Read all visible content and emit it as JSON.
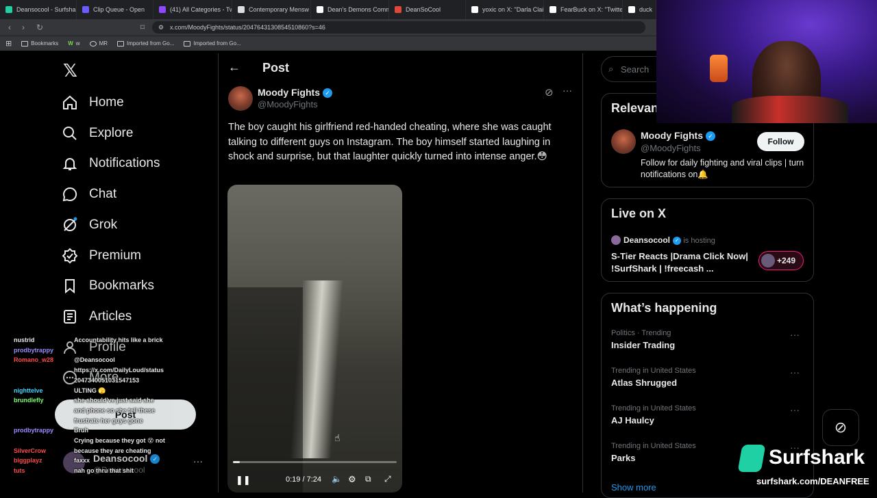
{
  "browser": {
    "tabs": [
      {
        "title": "Deansocool - Surfshark",
        "color": "#1ed0a4"
      },
      {
        "title": "Clip Queue - Open",
        "color": "#6a5cff"
      },
      {
        "title": "(41) All Categories - Tw",
        "color": "#9146ff"
      },
      {
        "title": "Contemporary Mensw",
        "color": "#dddddd"
      },
      {
        "title": "Dean's Demons Comm",
        "color": "#ffffff"
      },
      {
        "title": "DeanSoCool",
        "color": "#e0463a"
      },
      {
        "title": "yoxic on X: \"Darla Clair",
        "color": "#ffffff"
      },
      {
        "title": "FearBuck on X: \"Twitte",
        "color": "#ffffff"
      },
      {
        "title": "duck",
        "color": "#ffffff"
      }
    ],
    "url": "x.com/MoodyFights/status/2047643130854510860?s=46",
    "bookmarks": [
      "Bookmarks",
      "w",
      "MR",
      "Imported from Go...",
      "Imported from Go..."
    ]
  },
  "nav": {
    "items": [
      {
        "label": "Home",
        "icon": "home-icon"
      },
      {
        "label": "Explore",
        "icon": "search-icon"
      },
      {
        "label": "Notifications",
        "icon": "bell-icon"
      },
      {
        "label": "Chat",
        "icon": "chat-icon"
      },
      {
        "label": "Grok",
        "icon": "grok-icon"
      },
      {
        "label": "Premium",
        "icon": "premium-icon"
      },
      {
        "label": "Bookmarks",
        "icon": "bookmark-icon"
      },
      {
        "label": "Articles",
        "icon": "article-icon"
      },
      {
        "label": "Profile",
        "icon": "profile-icon"
      },
      {
        "label": "More",
        "icon": "more-icon"
      }
    ],
    "post_label": "Post",
    "account_name": "Deansocool",
    "account_handle": "@Deansocool"
  },
  "post": {
    "header": "Post",
    "author_name": "Moody Fights",
    "author_handle": "@MoodyFights",
    "text": "The boy caught his girlfriend red-handed cheating, where she was caught talking to different guys on Instagram. The boy himself started laughing in shock and surprise, but that laughter quickly turned into intense anger.😳",
    "video": {
      "time": "0:19 / 7:24",
      "progress": 0.043
    }
  },
  "sidebar": {
    "search_placeholder": "Search",
    "relevant_title": "Relevant people",
    "relevant": {
      "name": "Moody Fights",
      "handle": "@MoodyFights",
      "follow_label": "Follow",
      "bio": "Follow for daily fighting and viral clips | turn notifications on🔔"
    },
    "live_title": "Live on X",
    "live": {
      "host": "Deansocool",
      "hosting_label": "is hosting",
      "title": "S-Tier Reacts |Drama Click Now| !SurfShark | !freecash ...",
      "count": "+249"
    },
    "happening_title": "What’s happening",
    "trends": [
      {
        "meta": "Politics · Trending",
        "name": "Insider Trading"
      },
      {
        "meta": "Trending in United States",
        "name": "Atlas Shrugged"
      },
      {
        "meta": "Trending in United States",
        "name": "AJ Haulcy"
      },
      {
        "meta": "Trending in United States",
        "name": "Parks"
      }
    ],
    "show_more": "Show more"
  },
  "overlay": {
    "sponsor_name": "Surfshark",
    "sponsor_url": "surfshark.com/DEANFREE",
    "chat": [
      {
        "user": "nustrid",
        "msg": "Accountability hits like a brick",
        "color": "#e7e9ea"
      },
      {
        "user": "prodbytrappy",
        "msg": "",
        "color": "#9b8cff"
      },
      {
        "user": "Romano_w28",
        "msg": "@Deansocool",
        "color": "#ff4a4a"
      },
      {
        "user": "",
        "msg": "https://x.com/DailyLoud/status",
        "color": "#e7e9ea"
      },
      {
        "user": "",
        "msg": "2047340051031547153",
        "color": "#e7e9ea"
      },
      {
        "user": "nighttelve",
        "msg": "ULTING 🫣",
        "color": "#3fd4ff"
      },
      {
        "user": "brundlefly",
        "msg": "she should've just said she",
        "color": "#7cff6b"
      },
      {
        "user": "",
        "msg": "and phone so she tell these",
        "color": "#e7e9ea"
      },
      {
        "user": "",
        "msg": "frustrate her guys gone",
        "color": "#e7e9ea"
      },
      {
        "user": "prodbytrappy",
        "msg": "Bruh",
        "color": "#9b8cff"
      },
      {
        "user": "",
        "msg": "Crying because they got 😵 not",
        "color": "#e7e9ea"
      },
      {
        "user": "SilverCrow",
        "msg": "because they are cheating",
        "color": "#ff4a4a"
      },
      {
        "user": "biggplayz",
        "msg": "faxxx",
        "color": "#ff4a4a"
      },
      {
        "user": "tuts",
        "msg": "nah go thru that shit",
        "color": "#ff4a4a"
      }
    ]
  }
}
